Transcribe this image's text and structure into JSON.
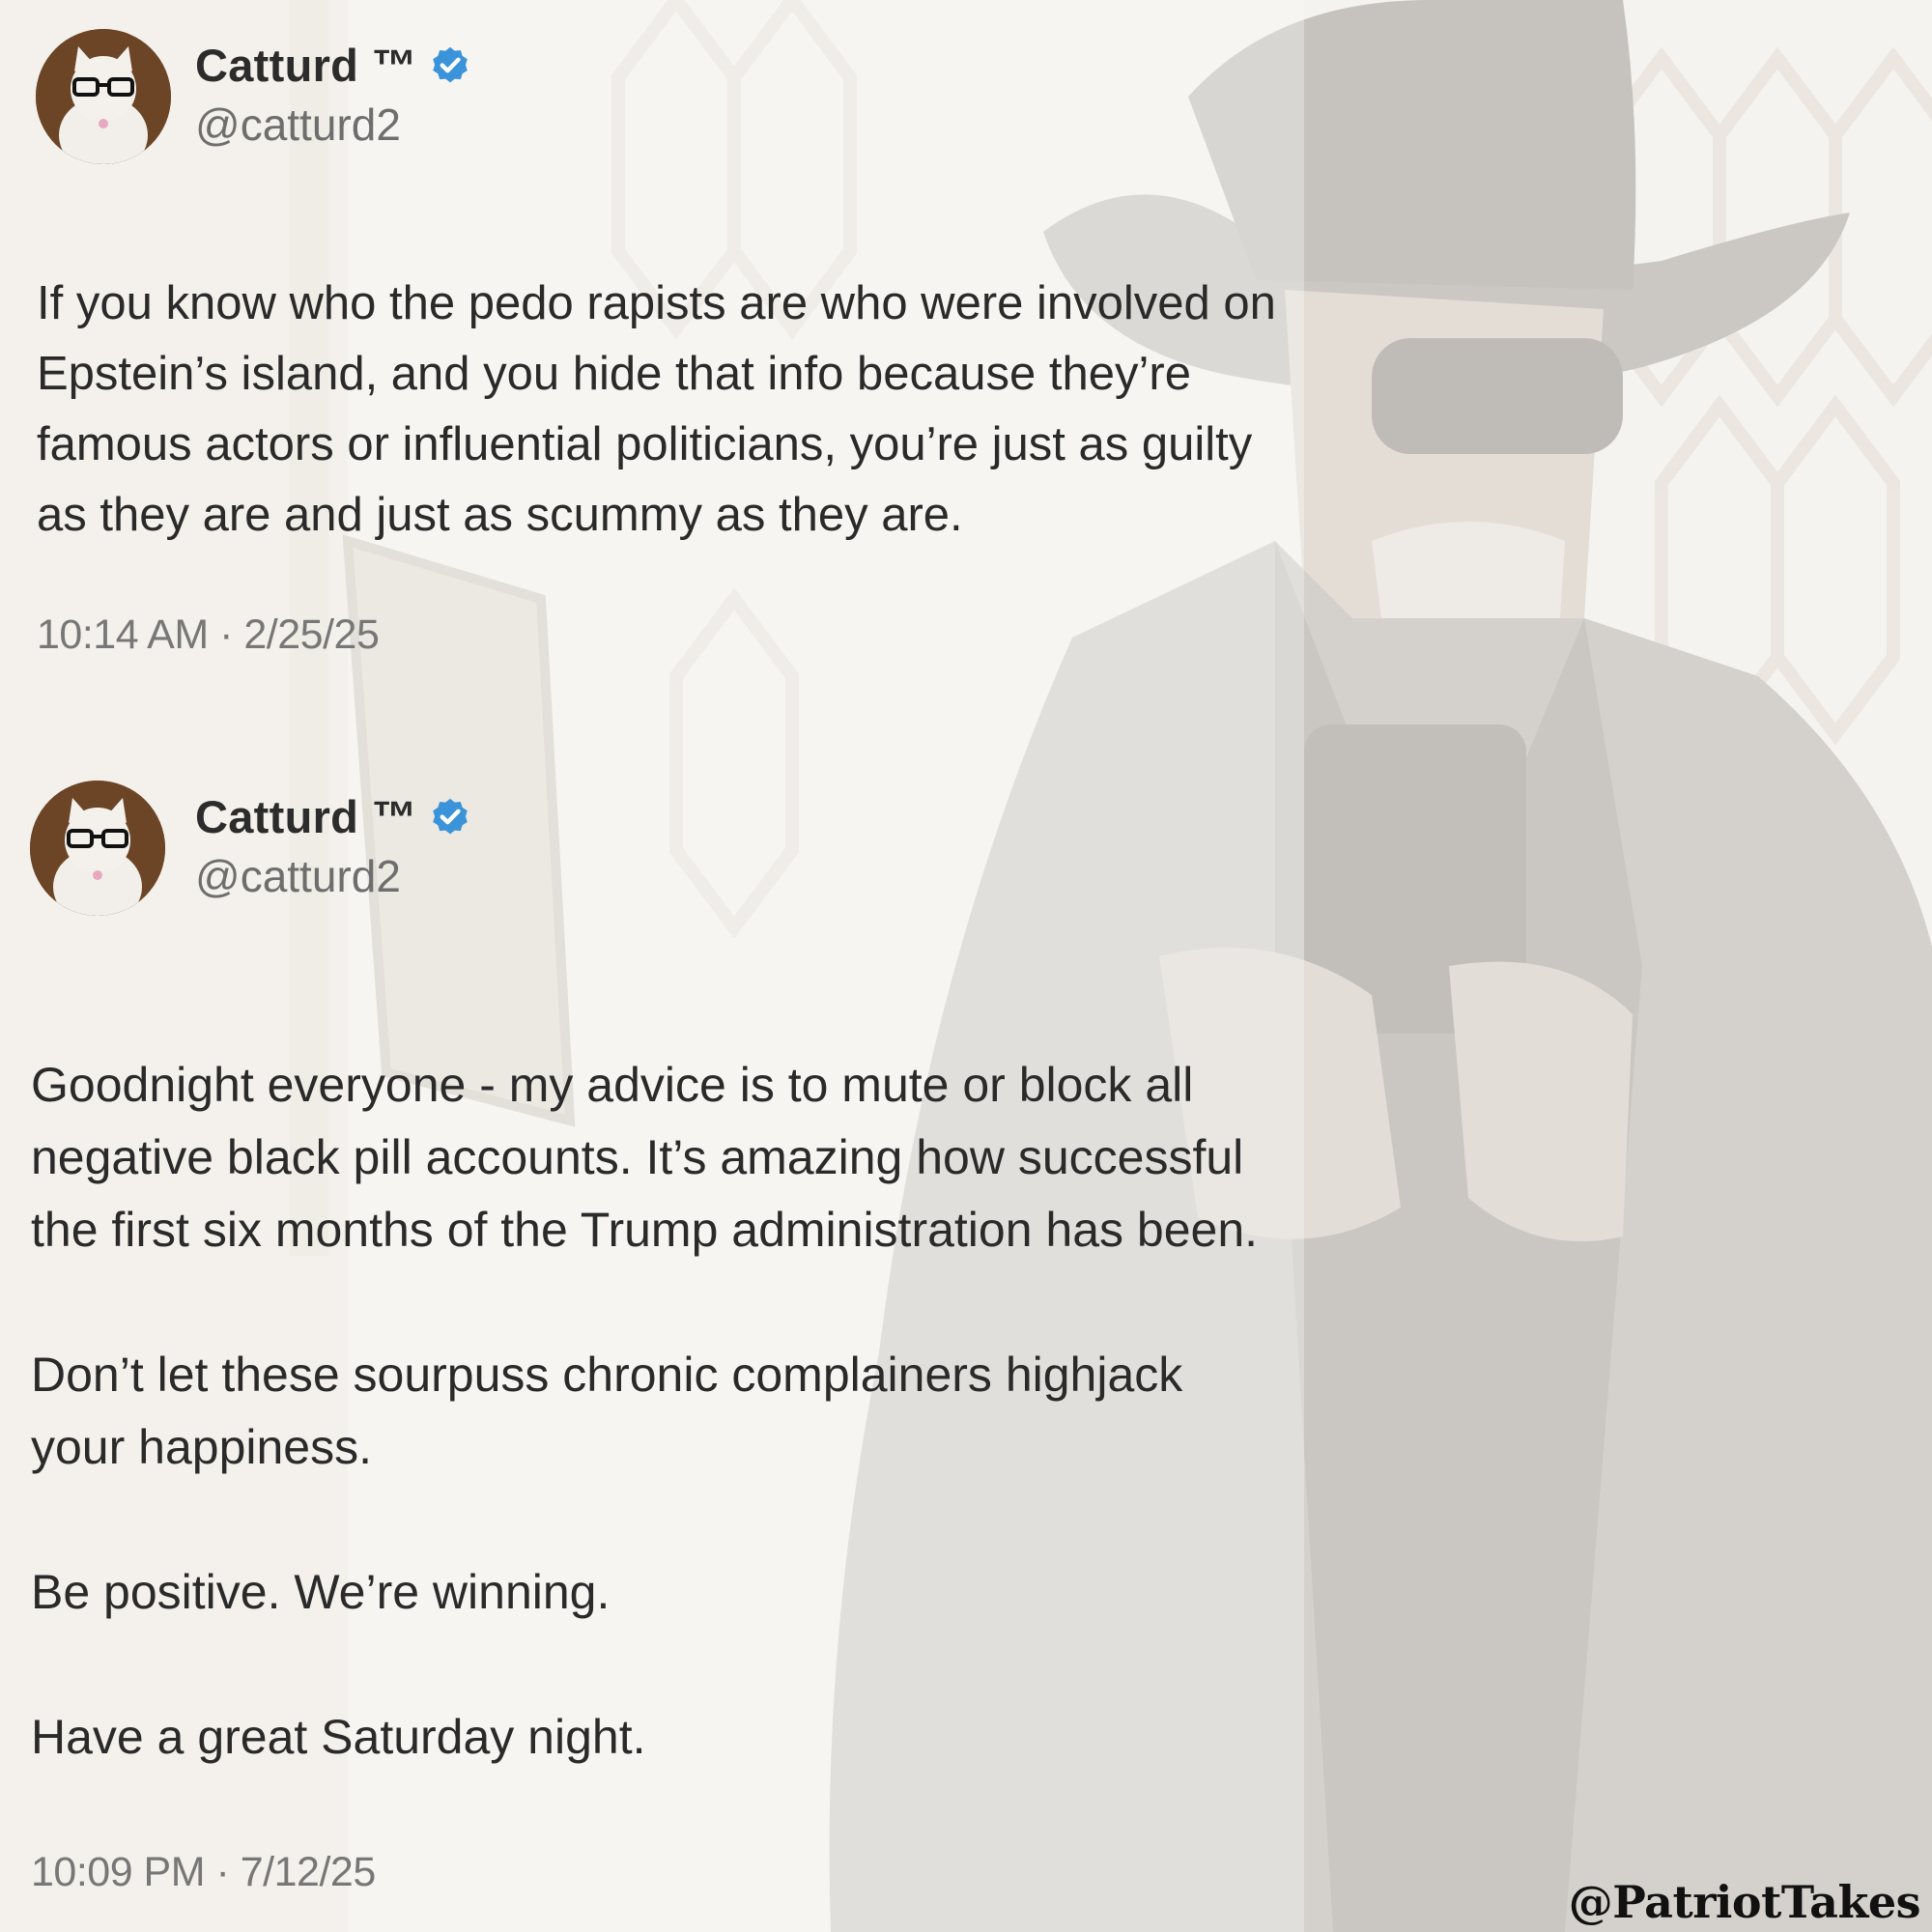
{
  "tweets": [
    {
      "display_name": "Catturd ™",
      "handle": "@catturd2",
      "text": "If you know who the pedo rapists are who were involved on Epstein’s island, and you hide that info because they’re famous actors or influential politicians, you’re just as guilty as they are and just as scummy as they are.",
      "timestamp": "10:14 AM · 2/25/25"
    },
    {
      "display_name": "Catturd ™",
      "handle": "@catturd2",
      "paragraphs": [
        "Goodnight everyone - my advice is to mute or block all negative black pill accounts. It’s amazing how successful the first six months of the Trump administration has been.",
        "Don’t let these sourpuss chronic complainers highjack your happiness.",
        "Be positive. We’re winning.",
        "Have a great Saturday night."
      ],
      "timestamp": "10:09 PM · 7/12/25"
    }
  ],
  "watermark": "@PatriotTakes",
  "colors": {
    "verified_badge": "#3b94d9",
    "text": "#2a2a2a",
    "secondary_text": "#6e6e6e"
  },
  "icons": {
    "verified": "verified-badge-icon",
    "avatar": "cat-with-glasses-avatar"
  }
}
